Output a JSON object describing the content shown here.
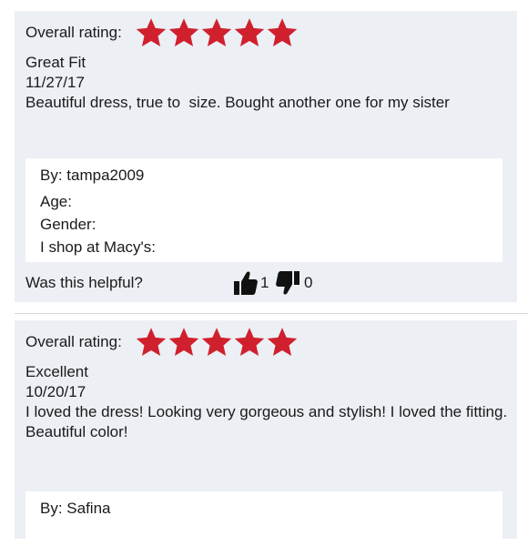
{
  "reviews": [
    {
      "rating_label": "Overall rating:",
      "rating": 5,
      "title": "Great Fit",
      "date": "11/27/17",
      "body": "Beautiful dress, true to  size. Bought another one for my sister",
      "user": {
        "by": "By: tampa2009",
        "age": "Age:",
        "gender": "Gender:",
        "shop": "I shop at Macy's:"
      },
      "helpful": {
        "label": "Was this helpful?",
        "up_count": "1",
        "down_count": "0"
      }
    },
    {
      "rating_label": "Overall rating:",
      "rating": 5,
      "title": "Excellent",
      "date": "10/20/17",
      "body": "I loved the dress! Looking very gorgeous and stylish! I loved the fitting. Beautiful color!",
      "user": {
        "by": "By: Safina"
      }
    }
  ],
  "colors": {
    "star": "#d0202e",
    "card_bg": "#eceff4",
    "inner_bg": "#ffffff",
    "icon": "#111111"
  },
  "icons": {
    "star": "star-icon",
    "thumbs_up": "thumbs-up-icon",
    "thumbs_down": "thumbs-down-icon"
  }
}
